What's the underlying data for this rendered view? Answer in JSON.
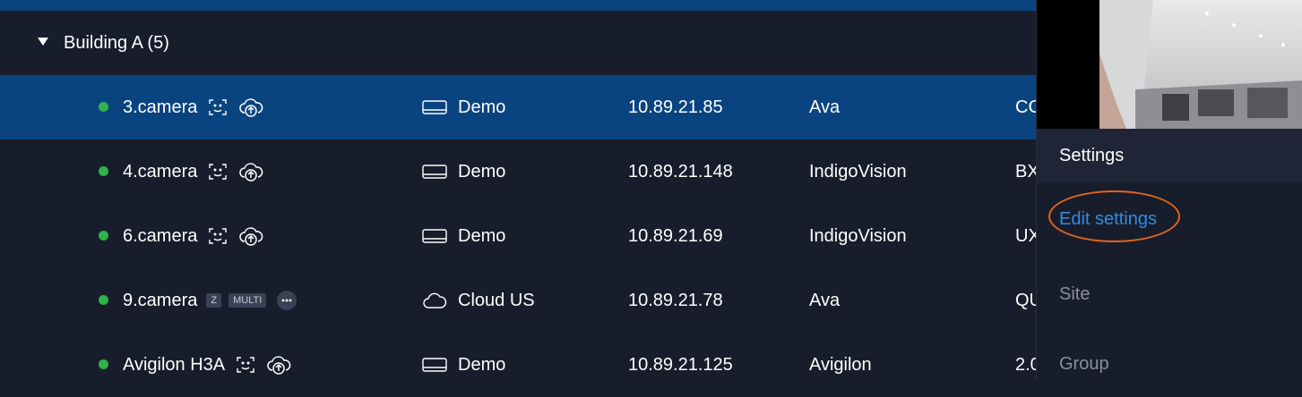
{
  "group": {
    "title": "Building A (5)"
  },
  "cameras": [
    {
      "name": "3.camera",
      "site": "Demo",
      "site_icon": "server-icon",
      "ip": "10.89.21.85",
      "vendor": "Ava",
      "model": "CC",
      "badges": []
    },
    {
      "name": "4.camera",
      "site": "Demo",
      "site_icon": "server-icon",
      "ip": "10.89.21.148",
      "vendor": "IndigoVision",
      "model": "BX",
      "badges": []
    },
    {
      "name": "6.camera",
      "site": "Demo",
      "site_icon": "server-icon",
      "ip": "10.89.21.69",
      "vendor": "IndigoVision",
      "model": "UX",
      "badges": []
    },
    {
      "name": "9.camera",
      "site": "Cloud US",
      "site_icon": "cloud-icon",
      "ip": "10.89.21.78",
      "vendor": "Ava",
      "model": "QU",
      "badges": [
        "Z",
        "MULTI"
      ]
    },
    {
      "name": "Avigilon H3A",
      "site": "Demo",
      "site_icon": "server-icon",
      "ip": "10.89.21.125",
      "vendor": "Avigilon",
      "model": "2.0",
      "badges": []
    }
  ],
  "panel": {
    "section_title": "Settings",
    "edit_link": "Edit settings",
    "site_label": "Site",
    "group_label": "Group"
  },
  "colors": {
    "background": "#181d2c",
    "selected_row": "#0a4480",
    "online_dot": "#2fb24a",
    "link": "#2f8de4",
    "highlight_ring": "#e0651e"
  }
}
